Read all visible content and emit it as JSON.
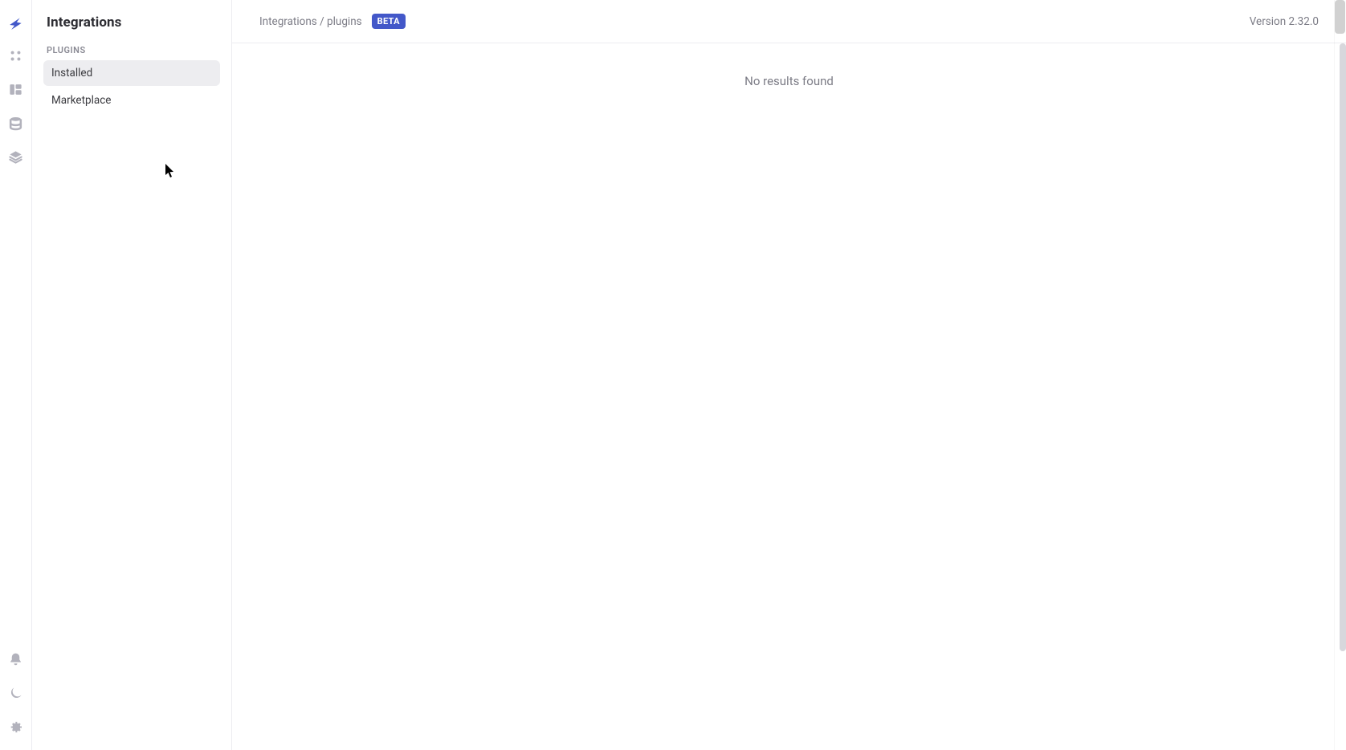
{
  "sidebar": {
    "title": "Integrations",
    "section_label": "PLUGINS",
    "items": [
      {
        "label": "Installed",
        "active": true
      },
      {
        "label": "Marketplace",
        "active": false
      }
    ]
  },
  "rail": {
    "top_icons": [
      "logo",
      "apps",
      "workspaces",
      "database",
      "stack"
    ],
    "bottom_icons": [
      "notifications",
      "theme",
      "settings"
    ]
  },
  "topbar": {
    "breadcrumb": "Integrations / plugins",
    "badge": "BETA",
    "version": "Version 2.32.0"
  },
  "main": {
    "empty_message": "No results found"
  }
}
